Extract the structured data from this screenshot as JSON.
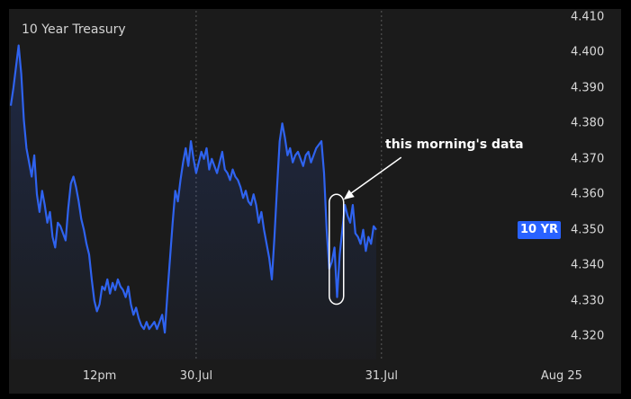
{
  "chart_data": {
    "type": "line",
    "title": "10 Year Treasury",
    "ylim": [
      4.316,
      4.412
    ],
    "y_ticks": [
      "4.410",
      "4.400",
      "4.390",
      "4.380",
      "4.370",
      "4.360",
      "4.350",
      "4.340",
      "4.330",
      "4.320"
    ],
    "x_ticks": [
      {
        "label": "12pm",
        "x": 34
      },
      {
        "label": "30.Jul",
        "x": 71
      },
      {
        "label": "31.Jul",
        "x": 142
      },
      {
        "label": "Aug 25",
        "x": 211
      }
    ],
    "xlim": [
      0,
      230
    ],
    "grid_dividers": [
      71,
      142
    ],
    "annotation": "this morning's data",
    "badge_label": "10 YR",
    "badge_value": 4.35,
    "colors": {
      "line": "#2f63ef",
      "badge": "#2962ff",
      "background": "#1b1b1b"
    },
    "series": [
      {
        "values": [
          [
            0,
            4.385
          ],
          [
            1,
            4.39
          ],
          [
            2,
            4.396
          ],
          [
            3,
            4.402
          ],
          [
            4,
            4.394
          ],
          [
            5,
            4.381
          ],
          [
            6,
            4.373
          ],
          [
            7,
            4.369
          ],
          [
            8,
            4.365
          ],
          [
            9,
            4.371
          ],
          [
            10,
            4.36
          ],
          [
            11,
            4.355
          ],
          [
            12,
            4.361
          ],
          [
            13,
            4.357
          ],
          [
            14,
            4.352
          ],
          [
            15,
            4.355
          ],
          [
            16,
            4.348
          ],
          [
            17,
            4.345
          ],
          [
            18,
            4.352
          ],
          [
            19,
            4.351
          ],
          [
            20,
            4.349
          ],
          [
            21,
            4.347
          ],
          [
            22,
            4.356
          ],
          [
            23,
            4.363
          ],
          [
            24,
            4.365
          ],
          [
            25,
            4.362
          ],
          [
            26,
            4.358
          ],
          [
            27,
            4.353
          ],
          [
            28,
            4.35
          ],
          [
            29,
            4.346
          ],
          [
            30,
            4.343
          ],
          [
            31,
            4.336
          ],
          [
            32,
            4.33
          ],
          [
            33,
            4.327
          ],
          [
            34,
            4.329
          ],
          [
            35,
            4.334
          ],
          [
            36,
            4.333
          ],
          [
            37,
            4.336
          ],
          [
            38,
            4.332
          ],
          [
            39,
            4.335
          ],
          [
            40,
            4.333
          ],
          [
            41,
            4.336
          ],
          [
            42,
            4.334
          ],
          [
            43,
            4.333
          ],
          [
            44,
            4.331
          ],
          [
            45,
            4.334
          ],
          [
            46,
            4.329
          ],
          [
            47,
            4.326
          ],
          [
            48,
            4.328
          ],
          [
            49,
            4.325
          ],
          [
            50,
            4.323
          ],
          [
            51,
            4.322
          ],
          [
            52,
            4.324
          ],
          [
            53,
            4.322
          ],
          [
            54,
            4.323
          ],
          [
            55,
            4.324
          ],
          [
            56,
            4.322
          ],
          [
            57,
            4.324
          ],
          [
            58,
            4.326
          ],
          [
            59,
            4.321
          ],
          [
            60,
            4.332
          ],
          [
            61,
            4.342
          ],
          [
            62,
            4.352
          ],
          [
            63,
            4.361
          ],
          [
            64,
            4.358
          ],
          [
            65,
            4.364
          ],
          [
            66,
            4.369
          ],
          [
            67,
            4.373
          ],
          [
            68,
            4.368
          ],
          [
            69,
            4.375
          ],
          [
            70,
            4.37
          ],
          [
            71,
            4.366
          ],
          [
            72,
            4.369
          ],
          [
            73,
            4.372
          ],
          [
            74,
            4.37
          ],
          [
            75,
            4.373
          ],
          [
            76,
            4.367
          ],
          [
            77,
            4.37
          ],
          [
            78,
            4.368
          ],
          [
            79,
            4.366
          ],
          [
            80,
            4.369
          ],
          [
            81,
            4.372
          ],
          [
            82,
            4.367
          ],
          [
            83,
            4.366
          ],
          [
            84,
            4.364
          ],
          [
            85,
            4.367
          ],
          [
            86,
            4.365
          ],
          [
            87,
            4.364
          ],
          [
            88,
            4.362
          ],
          [
            89,
            4.359
          ],
          [
            90,
            4.361
          ],
          [
            91,
            4.358
          ],
          [
            92,
            4.357
          ],
          [
            93,
            4.36
          ],
          [
            94,
            4.357
          ],
          [
            95,
            4.352
          ],
          [
            96,
            4.355
          ],
          [
            97,
            4.35
          ],
          [
            98,
            4.346
          ],
          [
            99,
            4.342
          ],
          [
            100,
            4.336
          ],
          [
            101,
            4.348
          ],
          [
            102,
            4.362
          ],
          [
            103,
            4.375
          ],
          [
            104,
            4.38
          ],
          [
            105,
            4.376
          ],
          [
            106,
            4.371
          ],
          [
            107,
            4.373
          ],
          [
            108,
            4.369
          ],
          [
            109,
            4.371
          ],
          [
            110,
            4.372
          ],
          [
            111,
            4.37
          ],
          [
            112,
            4.368
          ],
          [
            113,
            4.371
          ],
          [
            114,
            4.372
          ],
          [
            115,
            4.369
          ],
          [
            116,
            4.371
          ],
          [
            117,
            4.373
          ],
          [
            118,
            4.374
          ],
          [
            119,
            4.375
          ],
          [
            120,
            4.366
          ],
          [
            121,
            4.35
          ],
          [
            122,
            4.339
          ],
          [
            123,
            4.341
          ],
          [
            124,
            4.345
          ],
          [
            125,
            4.331
          ],
          [
            126,
            4.343
          ],
          [
            127,
            4.35
          ],
          [
            128,
            4.357
          ],
          [
            129,
            4.354
          ],
          [
            130,
            4.352
          ],
          [
            131,
            4.357
          ],
          [
            132,
            4.349
          ],
          [
            133,
            4.348
          ],
          [
            134,
            4.346
          ],
          [
            135,
            4.35
          ],
          [
            136,
            4.344
          ],
          [
            137,
            4.348
          ],
          [
            138,
            4.346
          ],
          [
            139,
            4.351
          ],
          [
            140,
            4.35
          ]
        ]
      }
    ]
  }
}
